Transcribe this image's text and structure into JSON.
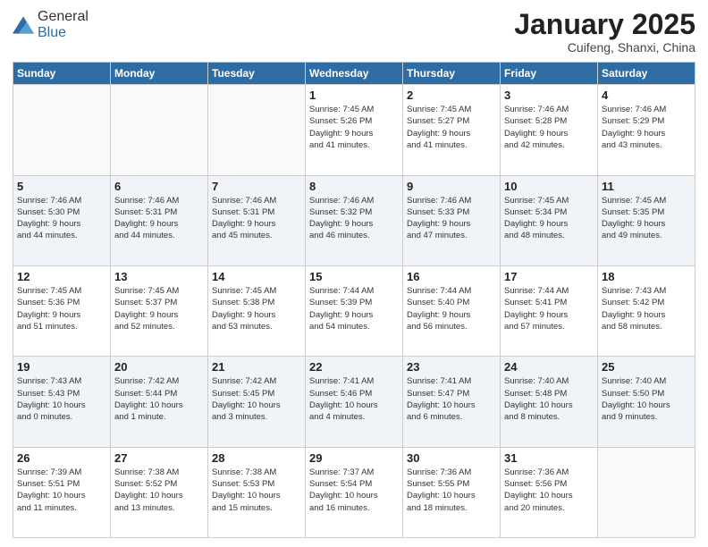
{
  "header": {
    "logo_general": "General",
    "logo_blue": "Blue",
    "month_title": "January 2025",
    "location": "Cuifeng, Shanxi, China"
  },
  "weekdays": [
    "Sunday",
    "Monday",
    "Tuesday",
    "Wednesday",
    "Thursday",
    "Friday",
    "Saturday"
  ],
  "weeks": [
    [
      {
        "day": "",
        "info": ""
      },
      {
        "day": "",
        "info": ""
      },
      {
        "day": "",
        "info": ""
      },
      {
        "day": "1",
        "info": "Sunrise: 7:45 AM\nSunset: 5:26 PM\nDaylight: 9 hours\nand 41 minutes."
      },
      {
        "day": "2",
        "info": "Sunrise: 7:45 AM\nSunset: 5:27 PM\nDaylight: 9 hours\nand 41 minutes."
      },
      {
        "day": "3",
        "info": "Sunrise: 7:46 AM\nSunset: 5:28 PM\nDaylight: 9 hours\nand 42 minutes."
      },
      {
        "day": "4",
        "info": "Sunrise: 7:46 AM\nSunset: 5:29 PM\nDaylight: 9 hours\nand 43 minutes."
      }
    ],
    [
      {
        "day": "5",
        "info": "Sunrise: 7:46 AM\nSunset: 5:30 PM\nDaylight: 9 hours\nand 44 minutes."
      },
      {
        "day": "6",
        "info": "Sunrise: 7:46 AM\nSunset: 5:31 PM\nDaylight: 9 hours\nand 44 minutes."
      },
      {
        "day": "7",
        "info": "Sunrise: 7:46 AM\nSunset: 5:31 PM\nDaylight: 9 hours\nand 45 minutes."
      },
      {
        "day": "8",
        "info": "Sunrise: 7:46 AM\nSunset: 5:32 PM\nDaylight: 9 hours\nand 46 minutes."
      },
      {
        "day": "9",
        "info": "Sunrise: 7:46 AM\nSunset: 5:33 PM\nDaylight: 9 hours\nand 47 minutes."
      },
      {
        "day": "10",
        "info": "Sunrise: 7:45 AM\nSunset: 5:34 PM\nDaylight: 9 hours\nand 48 minutes."
      },
      {
        "day": "11",
        "info": "Sunrise: 7:45 AM\nSunset: 5:35 PM\nDaylight: 9 hours\nand 49 minutes."
      }
    ],
    [
      {
        "day": "12",
        "info": "Sunrise: 7:45 AM\nSunset: 5:36 PM\nDaylight: 9 hours\nand 51 minutes."
      },
      {
        "day": "13",
        "info": "Sunrise: 7:45 AM\nSunset: 5:37 PM\nDaylight: 9 hours\nand 52 minutes."
      },
      {
        "day": "14",
        "info": "Sunrise: 7:45 AM\nSunset: 5:38 PM\nDaylight: 9 hours\nand 53 minutes."
      },
      {
        "day": "15",
        "info": "Sunrise: 7:44 AM\nSunset: 5:39 PM\nDaylight: 9 hours\nand 54 minutes."
      },
      {
        "day": "16",
        "info": "Sunrise: 7:44 AM\nSunset: 5:40 PM\nDaylight: 9 hours\nand 56 minutes."
      },
      {
        "day": "17",
        "info": "Sunrise: 7:44 AM\nSunset: 5:41 PM\nDaylight: 9 hours\nand 57 minutes."
      },
      {
        "day": "18",
        "info": "Sunrise: 7:43 AM\nSunset: 5:42 PM\nDaylight: 9 hours\nand 58 minutes."
      }
    ],
    [
      {
        "day": "19",
        "info": "Sunrise: 7:43 AM\nSunset: 5:43 PM\nDaylight: 10 hours\nand 0 minutes."
      },
      {
        "day": "20",
        "info": "Sunrise: 7:42 AM\nSunset: 5:44 PM\nDaylight: 10 hours\nand 1 minute."
      },
      {
        "day": "21",
        "info": "Sunrise: 7:42 AM\nSunset: 5:45 PM\nDaylight: 10 hours\nand 3 minutes."
      },
      {
        "day": "22",
        "info": "Sunrise: 7:41 AM\nSunset: 5:46 PM\nDaylight: 10 hours\nand 4 minutes."
      },
      {
        "day": "23",
        "info": "Sunrise: 7:41 AM\nSunset: 5:47 PM\nDaylight: 10 hours\nand 6 minutes."
      },
      {
        "day": "24",
        "info": "Sunrise: 7:40 AM\nSunset: 5:48 PM\nDaylight: 10 hours\nand 8 minutes."
      },
      {
        "day": "25",
        "info": "Sunrise: 7:40 AM\nSunset: 5:50 PM\nDaylight: 10 hours\nand 9 minutes."
      }
    ],
    [
      {
        "day": "26",
        "info": "Sunrise: 7:39 AM\nSunset: 5:51 PM\nDaylight: 10 hours\nand 11 minutes."
      },
      {
        "day": "27",
        "info": "Sunrise: 7:38 AM\nSunset: 5:52 PM\nDaylight: 10 hours\nand 13 minutes."
      },
      {
        "day": "28",
        "info": "Sunrise: 7:38 AM\nSunset: 5:53 PM\nDaylight: 10 hours\nand 15 minutes."
      },
      {
        "day": "29",
        "info": "Sunrise: 7:37 AM\nSunset: 5:54 PM\nDaylight: 10 hours\nand 16 minutes."
      },
      {
        "day": "30",
        "info": "Sunrise: 7:36 AM\nSunset: 5:55 PM\nDaylight: 10 hours\nand 18 minutes."
      },
      {
        "day": "31",
        "info": "Sunrise: 7:36 AM\nSunset: 5:56 PM\nDaylight: 10 hours\nand 20 minutes."
      },
      {
        "day": "",
        "info": ""
      }
    ]
  ]
}
